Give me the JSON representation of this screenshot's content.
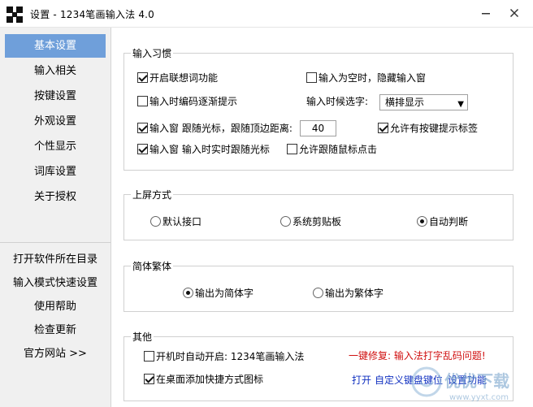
{
  "window": {
    "title": "设置 - 1234笔画输入法 4.0",
    "min_glyph": "—",
    "close_glyph": "✕"
  },
  "sidebar": {
    "items": [
      {
        "label": "基本设置",
        "active": true
      },
      {
        "label": "输入相关"
      },
      {
        "label": "按键设置"
      },
      {
        "label": "外观设置"
      },
      {
        "label": "个性显示"
      },
      {
        "label": "词库设置"
      },
      {
        "label": "关于授权"
      }
    ],
    "links": [
      {
        "label": "打开软件所在目录"
      },
      {
        "label": "输入模式快速设置"
      },
      {
        "label": "使用帮助"
      },
      {
        "label": "检查更新"
      },
      {
        "label": "官方网站 >>"
      }
    ]
  },
  "habits": {
    "title": "输入习惯",
    "association": {
      "label": "开启联想词功能",
      "checked": true
    },
    "hide_when_empty": {
      "label": "输入为空时，隐藏输入窗",
      "checked": false
    },
    "progressive_hint": {
      "label": "输入时编码逐渐提示",
      "checked": false
    },
    "candidate_label": "输入时候选字:",
    "candidate_value": "横排显示",
    "follow_cursor": {
      "label": "输入窗 跟随光标，跟随顶边距离:",
      "checked": true
    },
    "distance_value": "40",
    "key_hint": {
      "label": "允许有按键提示标签",
      "checked": true
    },
    "realtime_follow": {
      "label": "输入窗 输入时实时跟随光标",
      "checked": true
    },
    "mouse_follow": {
      "label": "允许跟随鼠标点击",
      "checked": false
    }
  },
  "commit": {
    "title": "上屏方式",
    "options": [
      {
        "label": "默认接口",
        "checked": false
      },
      {
        "label": "系统剪贴板",
        "checked": false
      },
      {
        "label": "自动判断",
        "checked": true
      }
    ]
  },
  "script": {
    "title": "简体繁体",
    "options": [
      {
        "label": "输出为简体字",
        "checked": true
      },
      {
        "label": "输出为繁体字",
        "checked": false
      }
    ]
  },
  "other": {
    "title": "其他",
    "autostart": {
      "label": "开机时自动开启: 1234笔画输入法",
      "checked": false
    },
    "shortcut": {
      "label": "在桌面添加快捷方式图标",
      "checked": true
    },
    "repair_link": "一键修复: 输入法打字乱码问题!",
    "open_link": "打开",
    "custom_link": "自定义键盘键位",
    "settings_link": "设置功能"
  },
  "watermark": {
    "text": "优优下载",
    "url": "www.yyxt.com"
  },
  "colors": {
    "accent": "#6f9fda",
    "link_red": "#d01010",
    "link_blue": "#1030c0"
  }
}
